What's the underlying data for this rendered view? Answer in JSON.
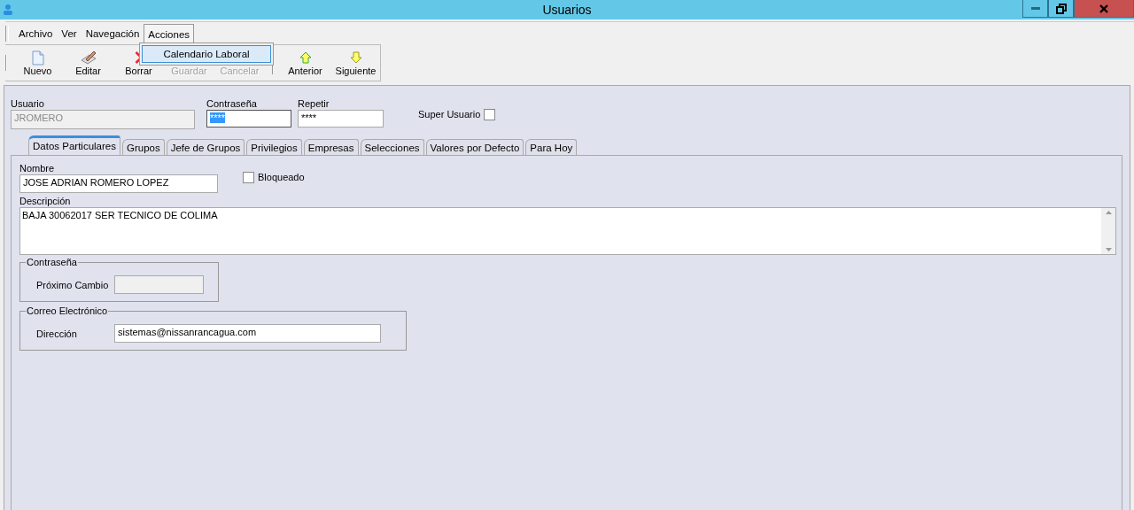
{
  "window": {
    "title": "Usuarios"
  },
  "menu": [
    {
      "label": "Archivo",
      "open": false
    },
    {
      "label": "Ver",
      "open": false
    },
    {
      "label": "Navegación",
      "open": false
    },
    {
      "label": "Acciones",
      "open": true
    }
  ],
  "dropdown": {
    "items": [
      {
        "label": "Calendario Laboral",
        "selected": true
      }
    ]
  },
  "toolbar": [
    {
      "label": "Nuevo",
      "kind": "new",
      "disabled": false
    },
    {
      "label": "Editar",
      "kind": "edit",
      "disabled": false
    },
    {
      "label": "Borrar",
      "kind": "delete",
      "disabled": false
    },
    {
      "label": "Guardar",
      "disabled": true
    },
    {
      "label": "Cancelar",
      "disabled": true
    },
    {
      "label": "Anterior",
      "kind": "up",
      "disabled": false
    },
    {
      "label": "Siguiente",
      "kind": "down",
      "disabled": false
    }
  ],
  "user_fields": [
    {
      "label": "Usuario",
      "value": "JROMERO",
      "disabled": true,
      "text_selected": false
    },
    {
      "label": "Contraseña",
      "value": "****",
      "disabled": false,
      "text_selected": true
    },
    {
      "label": "Repetir",
      "value": "****",
      "disabled": false,
      "text_selected": false
    }
  ],
  "super_usuario": {
    "label": "Super Usuario",
    "checked": false
  },
  "tabs": [
    {
      "label": "Datos Particulares",
      "selected": true
    },
    {
      "label": "Grupos",
      "selected": false
    },
    {
      "label": "Jefe de Grupos",
      "selected": false
    },
    {
      "label": "Privilegios",
      "selected": false
    },
    {
      "label": "Empresas",
      "selected": false
    },
    {
      "label": "Selecciones",
      "selected": false
    },
    {
      "label": "Valores por Defecto",
      "selected": false
    },
    {
      "label": "Para Hoy",
      "selected": false
    }
  ],
  "nombre": {
    "label": "Nombre",
    "value": "JOSE ADRIAN ROMERO LOPEZ"
  },
  "bloqueado": {
    "label": "Bloqueado",
    "checked": false
  },
  "descripcion": {
    "label": "Descripción",
    "value": "BAJA 30062017 SER TECNICO DE COLIMA"
  },
  "password_group": {
    "title": "Contraseña",
    "label": "Próximo Cambio",
    "disabled": true
  },
  "email_group": {
    "title": "Correo Electrónico",
    "label": "Dirección",
    "value": "sistemas@nissanrancagua.com",
    "disabled": false
  }
}
